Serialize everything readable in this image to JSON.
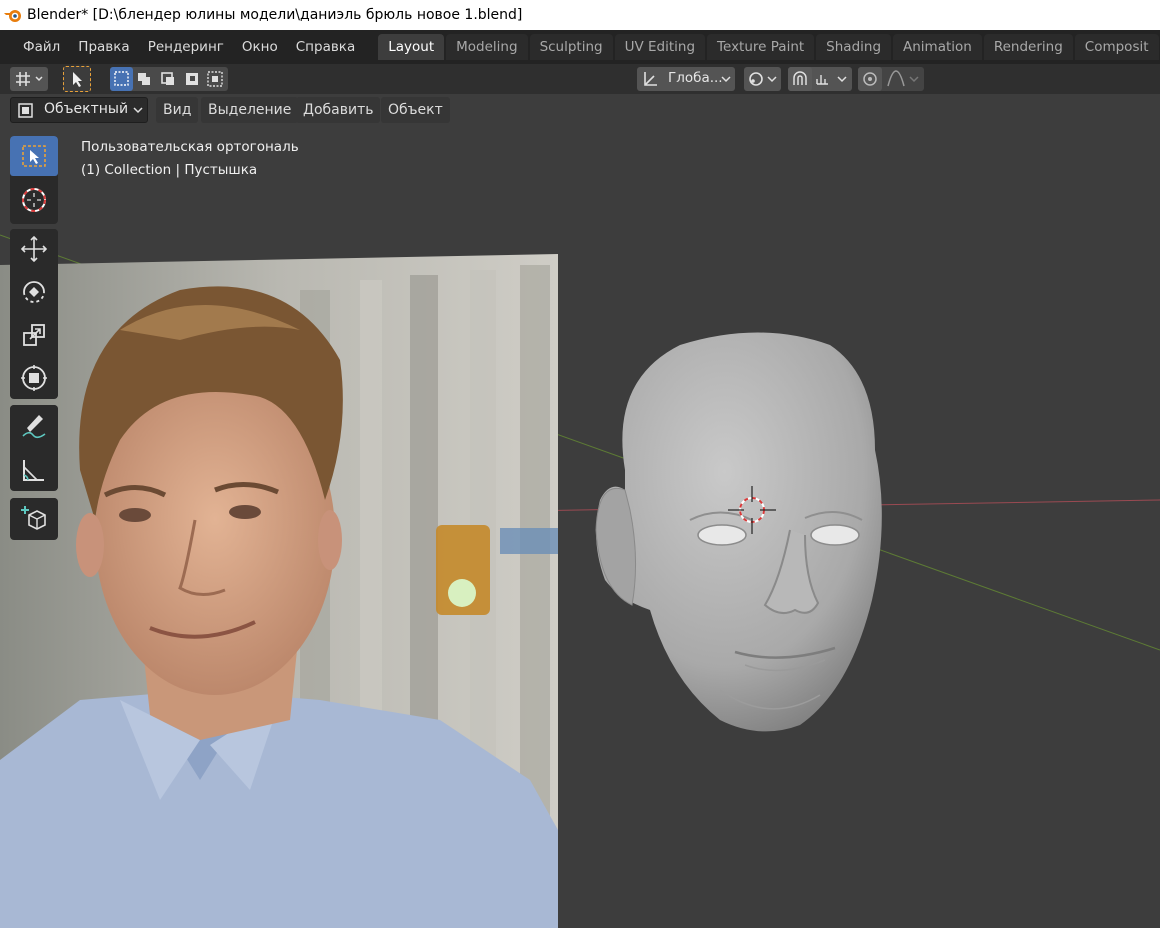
{
  "window": {
    "title": "Blender* [D:\\блендер юлины модели\\даниэль брюль новое 1.blend]"
  },
  "menus": [
    "Файл",
    "Правка",
    "Рендеринг",
    "Окно",
    "Справка"
  ],
  "workspace_tabs": [
    "Layout",
    "Modeling",
    "Sculpting",
    "UV Editing",
    "Texture Paint",
    "Shading",
    "Animation",
    "Rendering",
    "Composit"
  ],
  "active_tab": "Layout",
  "header": {
    "transform_orientation": "Глоба...",
    "mode": "Объектный",
    "view_menu": "Вид",
    "select_menu": "Выделение",
    "add_menu": "Добавить",
    "object_menu": "Объект"
  },
  "viewport": {
    "view_name": "Пользовательская ортогональ",
    "collection_info": "(1) Collection | Пустышка"
  },
  "tools": [
    "select-box",
    "cursor",
    "move",
    "rotate",
    "scale",
    "transform",
    "annotate",
    "measure",
    "add-cube"
  ],
  "colors": {
    "active": "#4772b3",
    "bg": "#3d3d3d",
    "x_axis": "#b0464f",
    "y_axis": "#6b8d3c"
  }
}
